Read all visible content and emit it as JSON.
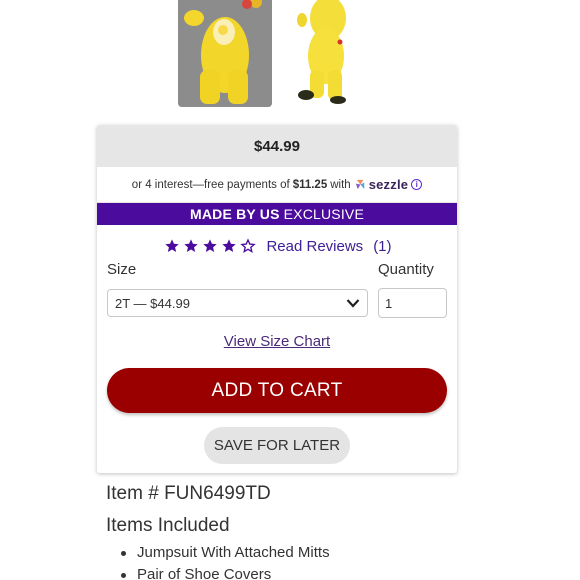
{
  "product": {
    "price": "$44.99",
    "sezzle": {
      "prefix": "or 4 interest—free payments of",
      "amount": "$11.25",
      "suffix": "with",
      "brand": "sezzle",
      "info_symbol": "i"
    },
    "exclusive_bold": "MADE BY US",
    "exclusive_rest": "EXCLUSIVE",
    "rating": {
      "value": 4,
      "max": 5
    },
    "read_reviews_label": "Read Reviews",
    "review_count": "(1)",
    "size_label": "Size",
    "quantity_label": "Quantity",
    "size_selected": "2T — $44.99",
    "quantity_value": "1",
    "size_chart_link": "View Size Chart",
    "add_to_cart_label": "ADD TO CART",
    "save_for_later_label": "SAVE FOR LATER",
    "item_number": "Item # FUN6499TD",
    "items_included_heading": "Items Included",
    "items_included": [
      "Jumpsuit With Attached Mitts",
      "Pair of Shoe Covers"
    ]
  },
  "colors": {
    "accent_purple": "#4b0c9e",
    "cart_red": "#9b0000",
    "link_purple": "#3d2096"
  },
  "icons": [
    "star-filled-icon",
    "star-outline-icon",
    "chevron-down-icon",
    "sezzle-logo-icon",
    "info-icon"
  ]
}
